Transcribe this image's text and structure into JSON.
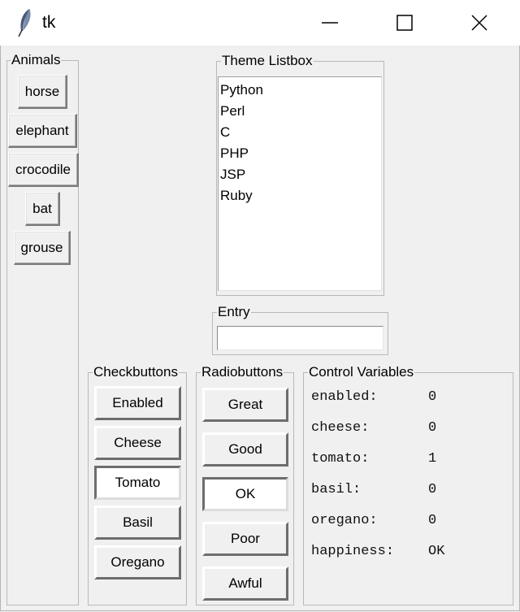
{
  "window": {
    "title": "tk",
    "icon": "feather-icon",
    "controls": [
      "minimize-icon",
      "maximize-icon",
      "close-icon"
    ]
  },
  "animals": {
    "label": "Animals",
    "buttons": [
      "horse",
      "elephant",
      "crocodile",
      "bat",
      "grouse"
    ]
  },
  "theme_listbox": {
    "label": "Theme Listbox",
    "items": [
      "Python",
      "Perl",
      "C",
      "PHP",
      "JSP",
      "Ruby"
    ]
  },
  "entry": {
    "label": "Entry",
    "value": ""
  },
  "checkbuttons": {
    "label": "Checkbuttons",
    "items": [
      {
        "label": "Enabled",
        "checked": false
      },
      {
        "label": "Cheese",
        "checked": false
      },
      {
        "label": "Tomato",
        "checked": true
      },
      {
        "label": "Basil",
        "checked": false
      },
      {
        "label": "Oregano",
        "checked": false
      }
    ]
  },
  "radiobuttons": {
    "label": "Radiobuttons",
    "items": [
      {
        "label": "Great",
        "selected": false
      },
      {
        "label": "Good",
        "selected": false
      },
      {
        "label": "OK",
        "selected": true
      },
      {
        "label": "Poor",
        "selected": false
      },
      {
        "label": "Awful",
        "selected": false
      }
    ]
  },
  "control_variables": {
    "label": "Control Variables",
    "rows": [
      {
        "name": "enabled:",
        "value": "0"
      },
      {
        "name": "cheese:",
        "value": "0"
      },
      {
        "name": "tomato:",
        "value": "1"
      },
      {
        "name": "basil:",
        "value": "0"
      },
      {
        "name": "oregano:",
        "value": "0"
      },
      {
        "name": "happiness:",
        "value": "OK"
      }
    ]
  }
}
